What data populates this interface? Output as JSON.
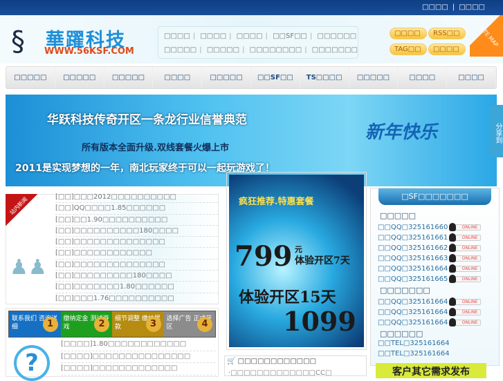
{
  "top_links": [
    "□□□□",
    "□□□□"
  ],
  "logo": {
    "name": "華躍科技",
    "url": "WWW.56KSF.COM"
  },
  "quick_links": {
    "row1": [
      "□□□□",
      "□□□□",
      "□□□□",
      "□□SF□□",
      "□□□□□□"
    ],
    "row2": [
      "□□□□□",
      "□□□□□",
      "□□□□□□□□",
      "□□□□□□□"
    ]
  },
  "side_buttons": [
    "□□□□",
    "RSS□□",
    "TAG□□",
    "□□□□"
  ],
  "sitemap": "SITE MAP",
  "nav": [
    "□□□□□",
    "□□□□□",
    "□□□□□",
    "□□□□",
    "□□□□□",
    "□□SF□□",
    "TS□□□□",
    "□□□□□",
    "□□□□",
    "□□□□"
  ],
  "banner": {
    "line1": "华跃科技传奇开区一条龙行业信誉典范",
    "line2": "所有版本全面升级.双线套餐火爆上市",
    "line3": "2011是实现梦想的一年，南北玩家终于可以一起玩游戏了！",
    "badge": "新年快乐"
  },
  "share": "分享到",
  "news": {
    "badge": "站内新闻",
    "items": [
      "[□□]□□□2012□□□□□□□□□□",
      "[□□]QQ□□□□1.85□□□□□□",
      "[□□]□□1.90□□□□□□□□□□",
      "[□□]□□□□□□□□□□180□□□□",
      "[□□]□□□□□□□□□□□□□□",
      "[□□]□□□□□□□□□□□□",
      "[□□]□□□□□□□□□□□□□□",
      "[□□]□□□□□□□□□180□□□□",
      "[□□]□□□□□□□1.80□□□□□□",
      "[□□]□□□1.76□□□□□□□□□□"
    ]
  },
  "steps": [
    {
      "text": "联系我们 咨询详细",
      "num": "1",
      "color": "#1570c4"
    },
    {
      "text": "缴纳定金 测试游戏",
      "num": "2",
      "color": "#1ea01e"
    },
    {
      "text": "细节调整 缴纳尾款",
      "num": "3",
      "color": "#b58c10"
    },
    {
      "text": "选择广告 正式开区",
      "num": "4",
      "color": "#8c8c8c"
    }
  ],
  "faq": [
    "[□□□□]1.80□□□□□□□□□□□□",
    "[□□□□]□□□□□□□□□□□□□□□",
    "[□□□□]□□□□□□□□□□□□□"
  ],
  "ad": {
    "title": "疯狂推荐.特惠套餐",
    "price1": "799",
    "unit": "元",
    "desc1": "体验开区7天",
    "desc2": "体验开区15天",
    "price2": "1099"
  },
  "shop": {
    "title": "□□□□□□□□□□□□",
    "line": "·□□□□□□□□□□□□□CC□"
  },
  "qq_panel": {
    "title": "□SF□□□□□□□",
    "online_label": "ONLINE",
    "sections": [
      {
        "title": "□□□□□",
        "rows": [
          "□□QQ□325161660",
          "□□QQ□325161661",
          "□□QQ□325161662",
          "□□QQ□325161663",
          "□□QQ□325161664",
          "□□QQ□325161665"
        ]
      },
      {
        "title": "□□□□□□□",
        "rows": [
          "□□QQ□325161664",
          "□□QQ□325161664",
          "□□QQ□325161664"
        ]
      },
      {
        "title": "□□□□□□",
        "rows": [
          "□□TEL□325161664",
          "□□TEL□325161664"
        ]
      }
    ]
  },
  "demand": "客户其它需求发布"
}
